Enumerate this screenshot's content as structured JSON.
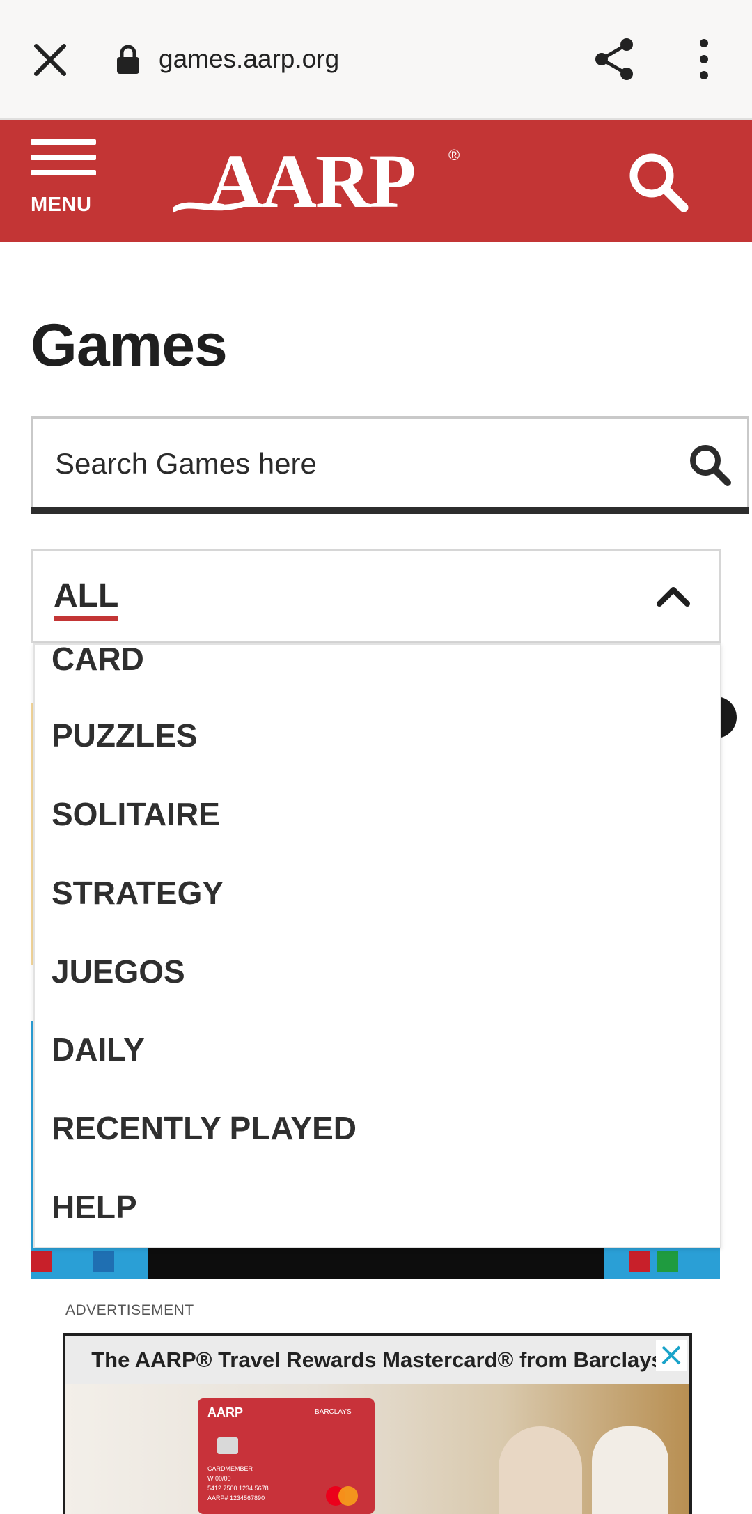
{
  "browser": {
    "url": "games.aarp.org"
  },
  "header": {
    "menu_label": "MENU",
    "logo_text": "AARP",
    "logo_mark": "®",
    "brand_color": "#c33535"
  },
  "main": {
    "title": "Games",
    "search": {
      "placeholder": "Search Games here",
      "value": ""
    },
    "category_select": {
      "selected": "ALL",
      "options": [
        "CARD",
        "PUZZLES",
        "SOLITAIRE",
        "STRATEGY",
        "JUEGOS",
        "DAILY",
        "RECENTLY PLAYED",
        "HELP"
      ]
    }
  },
  "ad": {
    "label": "ADVERTISEMENT",
    "headline": "The AARP® Travel Rewards Mastercard® from Barclays",
    "card_logo": "AARP",
    "card_bank": "BARCLAYS",
    "card_lines": [
      "CARDMEMBER",
      "W 00/00",
      "5412 7500 1234 5678",
      "AARP# 1234567890"
    ]
  }
}
